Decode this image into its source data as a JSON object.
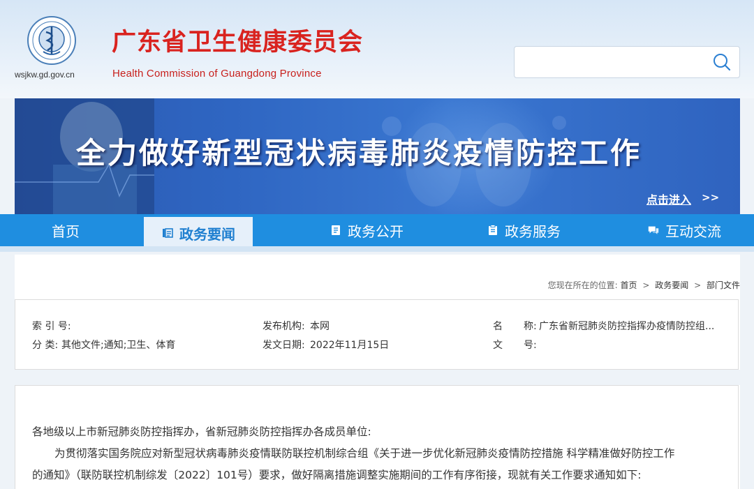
{
  "header": {
    "site_url": "wsjkw.gd.gov.cn",
    "title_cn": "广东省卫生健康委员会",
    "title_en": "Health Commission of Guangdong Province",
    "search": {
      "value": "",
      "placeholder": ""
    }
  },
  "banner": {
    "title": "全力做好新型冠状病毒肺炎疫情防控工作",
    "enter_label": "点击进入",
    "arrows": ">>"
  },
  "nav": {
    "items": [
      {
        "label": "首页",
        "icon": "home"
      },
      {
        "label": "政务要闻",
        "icon": "news-icon",
        "active": true
      },
      {
        "label": "政务公开",
        "icon": "doc-icon"
      },
      {
        "label": "政务服务",
        "icon": "clipboard-icon"
      },
      {
        "label": "互动交流",
        "icon": "chat-icon"
      }
    ]
  },
  "breadcrumb": {
    "prefix": "您现在所在的位置:",
    "items": [
      "首页",
      "政务要闻",
      "部门文件"
    ],
    "separator": ">"
  },
  "info": {
    "index_label": "索 引 号:",
    "index_value": "",
    "publisher_label": "发布机构:",
    "publisher_value": "本网",
    "name_label_1": "名",
    "name_label_2": "称:",
    "name_value": "广东省新冠肺炎防控指挥办疫情防控组...",
    "category_label": "分 类:",
    "category_value": "其他文件;通知;卫生、体育",
    "date_label": "发文日期:",
    "date_value": "2022年11月15日",
    "docno_label_1": "文",
    "docno_label_2": "号:",
    "docno_value": ""
  },
  "content": {
    "salutation": "各地级以上市新冠肺炎防控指挥办，省新冠肺炎防控指挥办各成员单位:",
    "para1_line1": "为贯彻落实国务院应对新型冠状病毒肺炎疫情联防联控机制综合组《关于进一步优化新冠肺炎疫情防控措施 科学精准做好防控工作",
    "para1_line2": "的通知》（联防联控机制综发〔2022〕101号）要求，做好隔离措施调整实施期间的工作有序衔接，现就有关工作要求通知如下:"
  },
  "colors": {
    "brand_red": "#d9231f",
    "nav_blue": "#1f8ee0",
    "banner_blue": "#2f66c2"
  }
}
